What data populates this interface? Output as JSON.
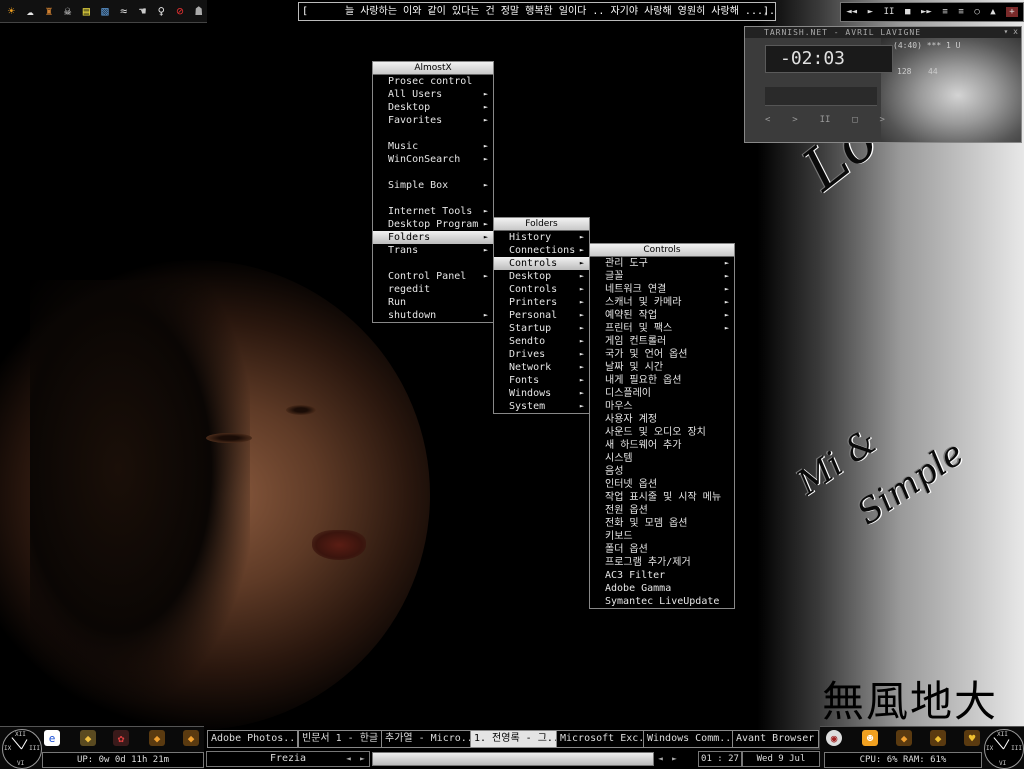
{
  "top_icons": [
    "sun-icon",
    "ghost-icon",
    "bottle-icon",
    "skull-icon",
    "note-icon",
    "package-icon",
    "wave-icon",
    "hand-icon",
    "bulb-icon",
    "no-sign-icon",
    "mascot-icon"
  ],
  "ticker": {
    "open": "[",
    "close": "]",
    "text": "늘 사랑하는 이와 같이 있다는 건 정말 행복한 일이다 .. 자기야 사랑해 영원히 사랑해 ....."
  },
  "media_buttons": [
    "◄◄",
    "►",
    "II",
    "■",
    "►►",
    "≡",
    "≡",
    "○",
    "▲",
    "+"
  ],
  "winamp": {
    "title": "TARNISH.NET - AVRIL LAVIGNE",
    "close": "▾ x",
    "time": "-02:03",
    "track_info": "(4:40)   *** 1  U",
    "kbps": "128",
    "khz": "44",
    "controls": [
      "<",
      ">",
      "II",
      "□",
      ">"
    ]
  },
  "menu_main": {
    "title": "AlmostX",
    "items": [
      {
        "label": "Prosec control",
        "arrow": ""
      },
      {
        "label": "All Users",
        "arrow": "►"
      },
      {
        "label": "Desktop",
        "arrow": "►"
      },
      {
        "label": "Favorites",
        "arrow": "►"
      },
      {
        "label": "",
        "arrow": "",
        "sep": true
      },
      {
        "label": "Music",
        "arrow": "►"
      },
      {
        "label": "WinConSearch",
        "arrow": "►"
      },
      {
        "label": "",
        "arrow": "",
        "sep": true
      },
      {
        "label": "Simple Box",
        "arrow": "►"
      },
      {
        "label": "",
        "arrow": "",
        "sep": true
      },
      {
        "label": "Internet Tools",
        "arrow": "►"
      },
      {
        "label": "Desktop Program",
        "arrow": "►"
      },
      {
        "label": "Folders",
        "arrow": "►",
        "selected": true
      },
      {
        "label": "Trans",
        "arrow": "►"
      },
      {
        "label": "",
        "arrow": "",
        "sep": true
      },
      {
        "label": "Control Panel",
        "arrow": "►"
      },
      {
        "label": "regedit",
        "arrow": ""
      },
      {
        "label": "Run",
        "arrow": ""
      },
      {
        "label": "shutdown",
        "arrow": "►"
      }
    ]
  },
  "menu_folders": {
    "title": "Folders",
    "items": [
      {
        "label": "History",
        "arrow": "►"
      },
      {
        "label": "Connections",
        "arrow": "►"
      },
      {
        "label": "Controls",
        "arrow": "►",
        "selected": true
      },
      {
        "label": "Desktop",
        "arrow": "►"
      },
      {
        "label": "Controls",
        "arrow": "►"
      },
      {
        "label": "Printers",
        "arrow": "►"
      },
      {
        "label": "Personal",
        "arrow": "►"
      },
      {
        "label": "Startup",
        "arrow": "►"
      },
      {
        "label": "Sendto",
        "arrow": "►"
      },
      {
        "label": "Drives",
        "arrow": "►"
      },
      {
        "label": "Network",
        "arrow": "►"
      },
      {
        "label": "Fonts",
        "arrow": "►"
      },
      {
        "label": "Windows",
        "arrow": "►"
      },
      {
        "label": "System",
        "arrow": "►"
      }
    ]
  },
  "menu_controls": {
    "title": "Controls",
    "items": [
      {
        "label": "관리 도구",
        "arrow": "►"
      },
      {
        "label": "글꼴",
        "arrow": "►"
      },
      {
        "label": "네트워크 연결",
        "arrow": "►"
      },
      {
        "label": "스캐너 및 카메라",
        "arrow": "►"
      },
      {
        "label": "예약된 작업",
        "arrow": "►"
      },
      {
        "label": "프린터 및 팩스",
        "arrow": "►"
      },
      {
        "label": "게임 컨트롤러",
        "arrow": ""
      },
      {
        "label": "국가 및 언어 옵션",
        "arrow": ""
      },
      {
        "label": "날짜 및 시간",
        "arrow": ""
      },
      {
        "label": "내게 필요한 옵션",
        "arrow": ""
      },
      {
        "label": "디스플레이",
        "arrow": ""
      },
      {
        "label": "마우스",
        "arrow": ""
      },
      {
        "label": "사용자 계정",
        "arrow": ""
      },
      {
        "label": "사운드 및 오디오 장치",
        "arrow": ""
      },
      {
        "label": "새 하드웨어 추가",
        "arrow": ""
      },
      {
        "label": "시스템",
        "arrow": ""
      },
      {
        "label": "음성",
        "arrow": ""
      },
      {
        "label": "인터넷 옵션",
        "arrow": ""
      },
      {
        "label": "작업 표시줄 및 시작 메뉴",
        "arrow": ""
      },
      {
        "label": "전원 옵션",
        "arrow": ""
      },
      {
        "label": "전화 및 모뎀 옵션",
        "arrow": ""
      },
      {
        "label": "키보드",
        "arrow": ""
      },
      {
        "label": "폴더 옵션",
        "arrow": ""
      },
      {
        "label": "프로그램 추가/제거",
        "arrow": ""
      },
      {
        "label": "AC3 Filter",
        "arrow": ""
      },
      {
        "label": "Adobe Gamma",
        "arrow": ""
      },
      {
        "label": "Symantec LiveUpdate",
        "arrow": ""
      }
    ]
  },
  "wallpaper": {
    "love": "Love is..",
    "mi": "Mi &",
    "simple": "Simple",
    "hanja": "無風地大"
  },
  "clock_numerals": {
    "xii": "XII",
    "ix": "IX",
    "iii": "III",
    "vi": "VI"
  },
  "taskbar": {
    "uptime": "UP: 0w 0d 11h 21m",
    "tasks": [
      {
        "label": "Adobe Photos...",
        "active": false
      },
      {
        "label": "빈문서 1 - 한글",
        "active": false
      },
      {
        "label": "추가열 - Micro...",
        "active": false
      },
      {
        "label": "1. 전영록 - 그...",
        "active": true
      },
      {
        "label": "Microsoft Exc...",
        "active": false
      },
      {
        "label": "Windows Comm...",
        "active": false
      },
      {
        "label": "Avant Browser",
        "active": false
      }
    ],
    "track": "Frezia",
    "time": "01 : 27",
    "date": "Wed 9 Jul",
    "cpu": "CPU: 6% RAM: 61%",
    "nav": {
      "prev": "◄",
      "next": "►"
    }
  },
  "colors": {
    "menu_bg": "#000000",
    "menu_sel": "#d0d0d0",
    "accent_red": "#7a2a2a"
  }
}
